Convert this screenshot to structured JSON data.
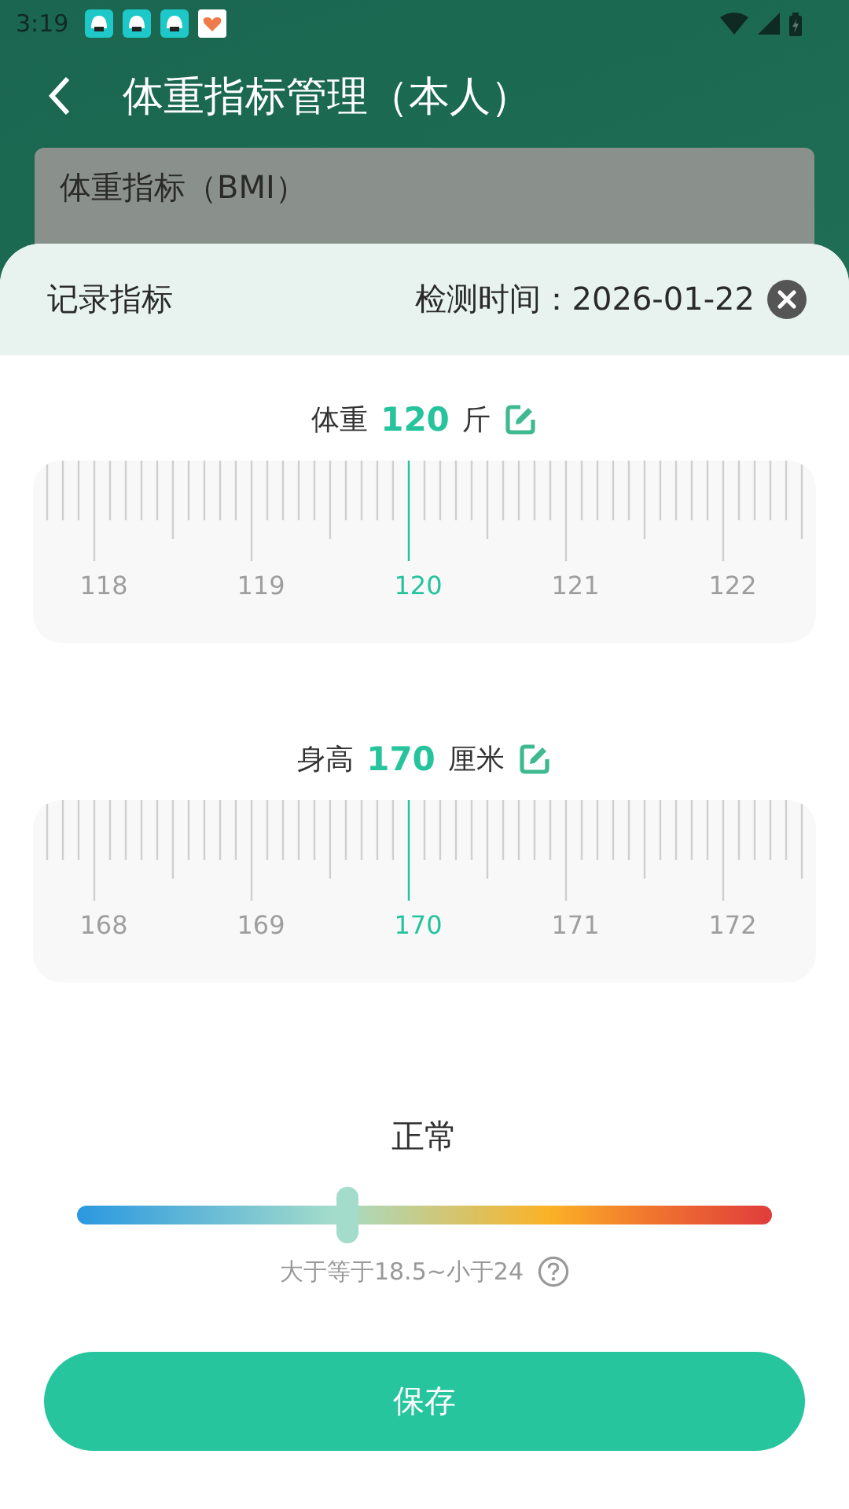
{
  "status_bar": {
    "time": "3:19"
  },
  "header": {
    "title": "体重指标管理（本人）"
  },
  "background_card": {
    "title": "体重指标（BMI）"
  },
  "sheet": {
    "title": "记录指标",
    "date": "检测时间：2026-01-22"
  },
  "measures": [
    {
      "label": "体重",
      "value": "120",
      "unit": "斤",
      "ticks": [
        {
          "label": "118",
          "selected": false
        },
        {
          "label": "119",
          "selected": false
        },
        {
          "label": "120",
          "selected": true
        },
        {
          "label": "121",
          "selected": false
        },
        {
          "label": "122",
          "selected": false
        }
      ]
    },
    {
      "label": "身高",
      "value": "170",
      "unit": "厘米",
      "ticks": [
        {
          "label": "168",
          "selected": false
        },
        {
          "label": "169",
          "selected": false
        },
        {
          "label": "170",
          "selected": true
        },
        {
          "label": "171",
          "selected": false
        },
        {
          "label": "172",
          "selected": false
        }
      ]
    }
  ],
  "result": {
    "label": "正常",
    "level": 0.39,
    "range": "大于等于18.5~小于24"
  },
  "save_button": "保存"
}
